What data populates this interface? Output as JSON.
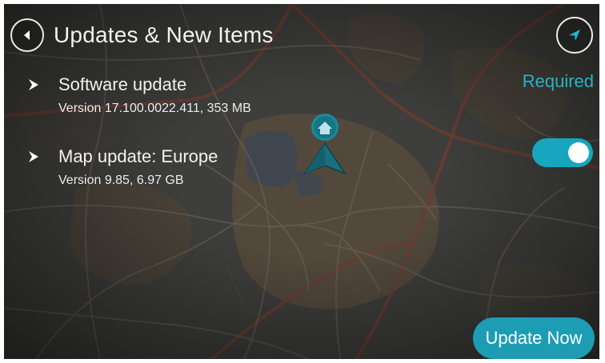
{
  "header": {
    "title": "Updates & New Items",
    "back_icon": "back-arrow-icon",
    "compass_icon": "navigation-arrow-icon"
  },
  "items": [
    {
      "name": "Software update",
      "detail": "Version 17.100.0022.411, 353 MB",
      "status": "Required",
      "icon": "chevron-right-icon"
    },
    {
      "name": "Map update: Europe",
      "detail": "Version 9.85, 6.97 GB",
      "toggle_on": true,
      "icon": "chevron-right-icon"
    }
  ],
  "actions": {
    "update_now_label": "Update Now"
  },
  "map": {
    "position_marker_icon": "home-location-icon"
  },
  "colors": {
    "accent": "#1c9db4",
    "accent_text": "#26b3c9",
    "text": "#f2f2f2"
  }
}
